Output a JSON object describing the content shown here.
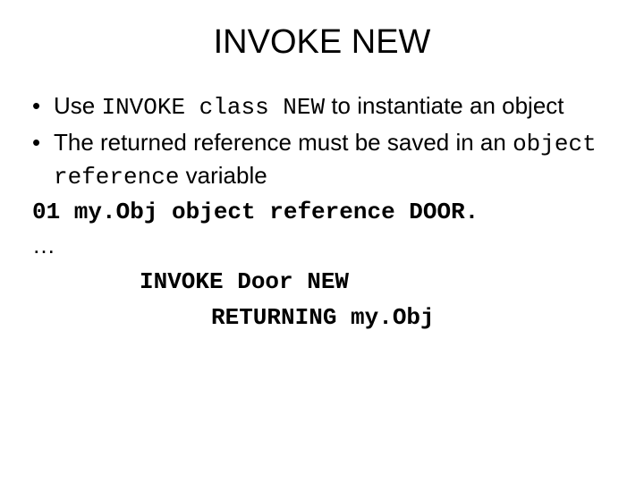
{
  "title": "INVOKE NEW",
  "bullets": [
    {
      "pre": "Use ",
      "code": "INVOKE class NEW",
      "post": " to instantiate an object"
    },
    {
      "pre": "The returned reference must be saved in an ",
      "code": "object reference",
      "post": " variable"
    }
  ],
  "code": {
    "decl": "01 my.Obj object reference DOOR.",
    "ellipsis": "…",
    "invoke": "INVOKE Door NEW",
    "returning": "RETURNING my.Obj"
  }
}
